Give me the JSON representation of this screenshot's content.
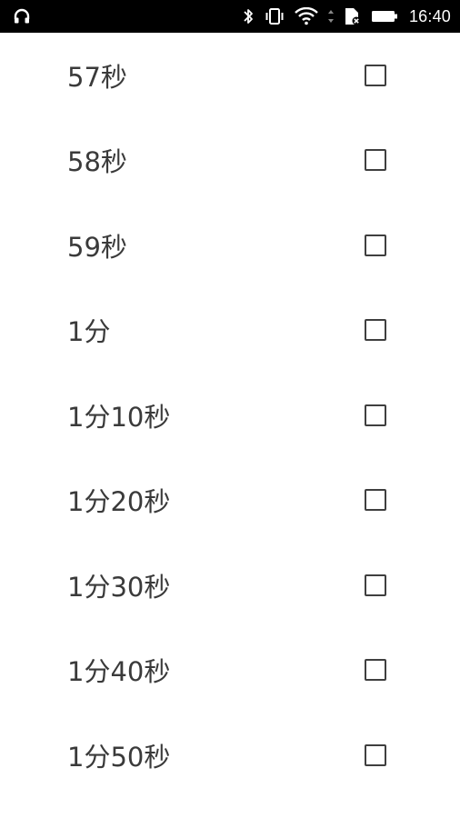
{
  "status_bar": {
    "time": "16:40",
    "icons": [
      "headphones-icon",
      "bluetooth-icon",
      "vibrate-icon",
      "wifi-icon",
      "data-arrows-icon",
      "sim-no-signal-icon",
      "battery-icon"
    ]
  },
  "list": {
    "items": [
      {
        "label": "57秒",
        "checked": false
      },
      {
        "label": "58秒",
        "checked": false
      },
      {
        "label": "59秒",
        "checked": false
      },
      {
        "label": "1分",
        "checked": false
      },
      {
        "label": "1分10秒",
        "checked": false
      },
      {
        "label": "1分20秒",
        "checked": false
      },
      {
        "label": "1分30秒",
        "checked": false
      },
      {
        "label": "1分40秒",
        "checked": false
      },
      {
        "label": "1分50秒",
        "checked": false
      }
    ]
  },
  "colors": {
    "status_bar_bg": "#000000",
    "text": "#3a3a3a",
    "checkbox_border": "#3f3f3f",
    "background": "#ffffff"
  }
}
